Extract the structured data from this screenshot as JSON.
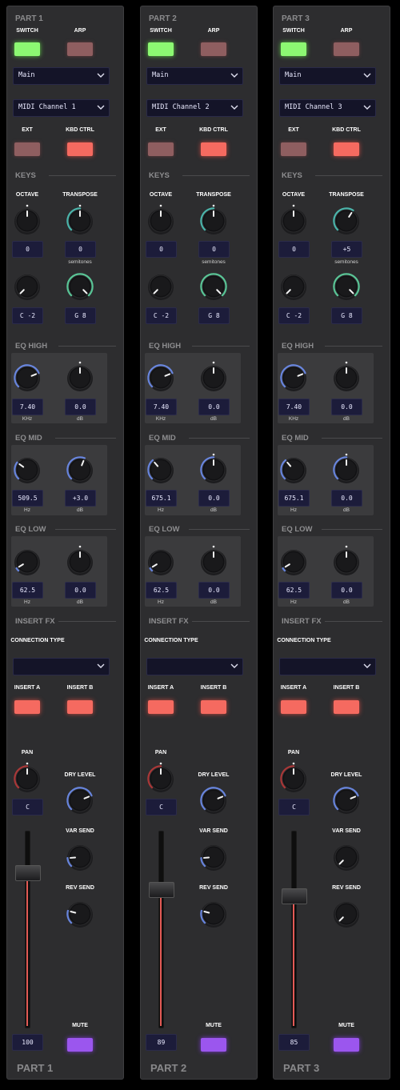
{
  "strips": [
    {
      "title": "PART 1",
      "switch_label": "SWITCH",
      "arp_label": "ARP",
      "switch_state": "on",
      "arp_state": "off",
      "route_value": "Main",
      "midi_value": "MIDI Channel 1",
      "ext_label": "EXT",
      "kbd_label": "KBD CTRL",
      "ext_state": "off",
      "kbd_state": "on",
      "keys": {
        "heading": "KEYS",
        "octave_label": "OCTAVE",
        "transpose_label": "TRANSPOSE",
        "octave_value": "0",
        "transpose_value": "0",
        "transpose_unit": "semitones",
        "note_low": "C -2",
        "note_high": "G 8"
      },
      "eq_high": {
        "heading": "EQ HIGH",
        "freq": "7.40",
        "freq_unit": "KHz",
        "gain": "0.0",
        "gain_unit": "dB"
      },
      "eq_mid": {
        "heading": "EQ MID",
        "freq": "509.5",
        "freq_unit": "Hz",
        "gain": "+3.0",
        "gain_unit": "dB"
      },
      "eq_low": {
        "heading": "EQ LOW",
        "freq": "62.5",
        "freq_unit": "Hz",
        "gain": "0.0",
        "gain_unit": "dB"
      },
      "insert": {
        "heading": "INSERT FX",
        "conn_label": "CONNECTION TYPE",
        "conn_value": "",
        "a_label": "INSERT A",
        "b_label": "INSERT B"
      },
      "pan_label": "PAN",
      "pan_value": "C",
      "dry_label": "DRY LEVEL",
      "var_label": "VAR SEND",
      "rev_label": "REV SEND",
      "level_value": "100",
      "level": 100,
      "mute_label": "MUTE",
      "part_label": "PART 1",
      "knobs": {
        "octave": 0.5,
        "transpose": 0.5,
        "note_low": 0.0,
        "note_high": 1.0,
        "eqh_freq": 0.75,
        "eqh_gain": 0.5,
        "eqm_freq": 0.3,
        "eqm_gain": 0.58,
        "eql_freq": 0.05,
        "eql_gain": 0.5,
        "pan": 0.5,
        "dry": 0.75,
        "var": 0.15,
        "rev": 0.22
      }
    },
    {
      "title": "PART 2",
      "switch_label": "SWITCH",
      "arp_label": "ARP",
      "switch_state": "on",
      "arp_state": "off",
      "route_value": "Main",
      "midi_value": "MIDI Channel 2",
      "ext_label": "EXT",
      "kbd_label": "KBD CTRL",
      "ext_state": "off",
      "kbd_state": "on",
      "keys": {
        "heading": "KEYS",
        "octave_label": "OCTAVE",
        "transpose_label": "TRANSPOSE",
        "octave_value": "0",
        "transpose_value": "0",
        "transpose_unit": "semitones",
        "note_low": "C -2",
        "note_high": "G 8"
      },
      "eq_high": {
        "heading": "EQ HIGH",
        "freq": "7.40",
        "freq_unit": "KHz",
        "gain": "0.0",
        "gain_unit": "dB"
      },
      "eq_mid": {
        "heading": "EQ MID",
        "freq": "675.1",
        "freq_unit": "Hz",
        "gain": "0.0",
        "gain_unit": "dB"
      },
      "eq_low": {
        "heading": "EQ LOW",
        "freq": "62.5",
        "freq_unit": "Hz",
        "gain": "0.0",
        "gain_unit": "dB"
      },
      "insert": {
        "heading": "INSERT FX",
        "conn_label": "CONNECTION TYPE",
        "conn_value": "",
        "a_label": "INSERT A",
        "b_label": "INSERT B"
      },
      "pan_label": "PAN",
      "pan_value": "C",
      "dry_label": "DRY LEVEL",
      "var_label": "VAR SEND",
      "rev_label": "REV SEND",
      "level_value": "89",
      "level": 89,
      "mute_label": "MUTE",
      "part_label": "PART 2",
      "knobs": {
        "octave": 0.5,
        "transpose": 0.5,
        "note_low": 0.0,
        "note_high": 1.0,
        "eqh_freq": 0.75,
        "eqh_gain": 0.5,
        "eqm_freq": 0.35,
        "eqm_gain": 0.5,
        "eql_freq": 0.05,
        "eql_gain": 0.5,
        "pan": 0.5,
        "dry": 0.75,
        "var": 0.15,
        "rev": 0.22
      }
    },
    {
      "title": "PART 3",
      "switch_label": "SWITCH",
      "arp_label": "ARP",
      "switch_state": "on",
      "arp_state": "off",
      "route_value": "Main",
      "midi_value": "MIDI Channel 3",
      "ext_label": "EXT",
      "kbd_label": "KBD CTRL",
      "ext_state": "off",
      "kbd_state": "on",
      "keys": {
        "heading": "KEYS",
        "octave_label": "OCTAVE",
        "transpose_label": "TRANSPOSE",
        "octave_value": "0",
        "transpose_value": "+5",
        "transpose_unit": "semitones",
        "note_low": "C -2",
        "note_high": "G 8"
      },
      "eq_high": {
        "heading": "EQ HIGH",
        "freq": "7.40",
        "freq_unit": "KHz",
        "gain": "0.0",
        "gain_unit": "dB"
      },
      "eq_mid": {
        "heading": "EQ MID",
        "freq": "675.1",
        "freq_unit": "Hz",
        "gain": "0.0",
        "gain_unit": "dB"
      },
      "eq_low": {
        "heading": "EQ LOW",
        "freq": "62.5",
        "freq_unit": "Hz",
        "gain": "0.0",
        "gain_unit": "dB"
      },
      "insert": {
        "heading": "INSERT FX",
        "conn_label": "CONNECTION TYPE",
        "conn_value": "",
        "a_label": "INSERT A",
        "b_label": "INSERT B"
      },
      "pan_label": "PAN",
      "pan_value": "C",
      "dry_label": "DRY LEVEL",
      "var_label": "VAR SEND",
      "rev_label": "REV SEND",
      "level_value": "85",
      "level": 85,
      "mute_label": "MUTE",
      "part_label": "PART 3",
      "knobs": {
        "octave": 0.5,
        "transpose": 0.62,
        "note_low": 0.0,
        "note_high": 1.0,
        "eqh_freq": 0.75,
        "eqh_gain": 0.5,
        "eqm_freq": 0.35,
        "eqm_gain": 0.5,
        "eql_freq": 0.05,
        "eql_gain": 0.5,
        "pan": 0.5,
        "dry": 0.75,
        "var": 0.0,
        "rev": 0.0
      }
    }
  ],
  "colors": {
    "knob_arc_blue": "#6f8ff0",
    "knob_arc_green": "#5fd6a2",
    "knob_arc_teal": "#4fc3b8",
    "knob_arc_red": "#b83a3a",
    "button_on_green": "#8cf872",
    "button_red": "#f56a60",
    "button_purple": "#9b56ee",
    "display_bg": "#1c1c3a"
  }
}
